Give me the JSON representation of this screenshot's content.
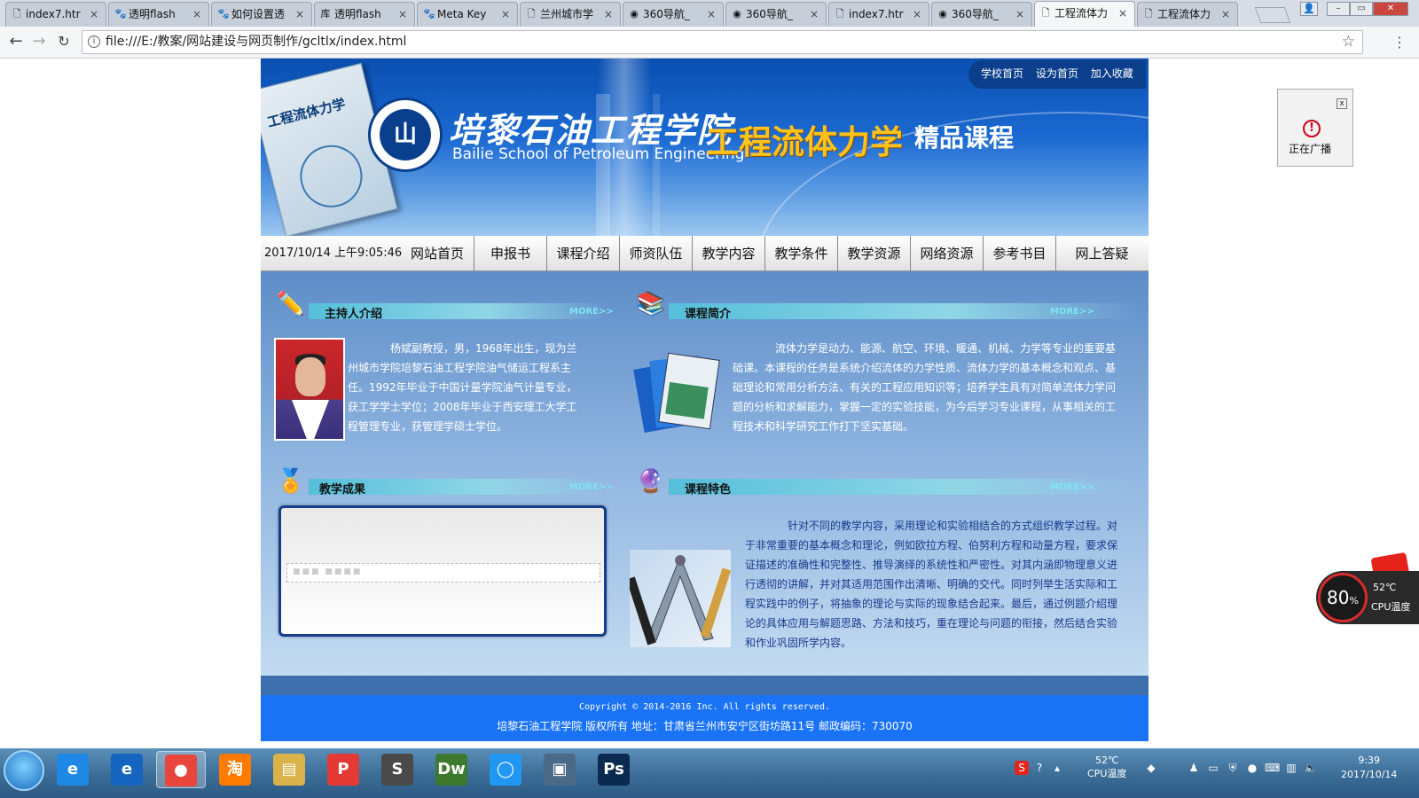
{
  "browser": {
    "tabs": [
      {
        "title": "index7.htr",
        "icon": "doc"
      },
      {
        "title": "透明flash",
        "icon": "baidu-paw"
      },
      {
        "title": "如何设置透",
        "icon": "baidu-paw"
      },
      {
        "title": "透明flash",
        "icon": "wenku"
      },
      {
        "title": "Meta Key",
        "icon": "baidu-paw"
      },
      {
        "title": "兰州城市学",
        "icon": "doc"
      },
      {
        "title": "360导航_",
        "icon": "360"
      },
      {
        "title": "360导航_",
        "icon": "360"
      },
      {
        "title": "index7.htr",
        "icon": "doc"
      },
      {
        "title": "360导航_",
        "icon": "360"
      },
      {
        "title": "工程流体力",
        "icon": "doc"
      },
      {
        "title": "工程流体力",
        "icon": "doc"
      }
    ],
    "active_tab": 10,
    "url": "file:///E:/教案/网站建设与网页制作/gcltlx/index.html"
  },
  "site": {
    "top_links": [
      "学校首页",
      "设为首页",
      "加入收藏"
    ],
    "book_title": "工程流体力学",
    "school_cn": "培黎石油工程学院",
    "school_en": "Bailie School of Petroleum Engineering",
    "seal_text": "山",
    "course_name": "工程流体力学",
    "course_tag": "精品课程",
    "clock": "2017/10/14  上午9:05:46",
    "nav": [
      "网站首页",
      "申报书",
      "课程介绍",
      "师资队伍",
      "教学内容",
      "教学条件",
      "教学资源",
      "网络资源",
      "参考书目",
      "网上答疑"
    ],
    "sections": {
      "host": {
        "title": "主持人介绍",
        "more": "MORE>>",
        "text": "杨斌副教授，男，1968年出生，现为兰州城市学院培黎石油工程学院油气储运工程系主任。1992年毕业于中国计量学院油气计量专业，获工学学士学位；2008年毕业于西安理工大学工程管理专业，获管理学硕士学位。"
      },
      "intro": {
        "title": "课程简介",
        "more": "MORE>>",
        "text": "流体力学是动力、能源、航空、环境、暖通、机械、力学等专业的重要基础课。本课程的任务是系统介绍流体的力学性质、流体力学的基本概念和观点、基础理论和常用分析方法、有关的工程应用知识等；培养学生具有对简单流体力学问题的分析和求解能力，掌握一定的实验技能，为今后学习专业课程，从事相关的工程技术和科学研究工作打下坚实基础。"
      },
      "results": {
        "title": "教学成果",
        "more": "MORE>>",
        "loading": "■■■ ■■■■"
      },
      "features": {
        "title": "课程特色",
        "more": "MORE>>",
        "text": "针对不同的教学内容，采用理论和实验相结合的方式组织教学过程。对于非常重要的基本概念和理论，例如欧拉方程、伯努利方程和动量方程，要求保证描述的准确性和完整性、推导演绎的系统性和严密性。对其内涵即物理意义进行透彻的讲解，并对其适用范围作出清晰、明确的交代。同时列举生活实际和工程实践中的例子，将抽象的理论与实际的现象结合起来。最后，通过例题介绍理论的具体应用与解题思路、方法和技巧，重在理论与问题的衔接，然后结合实验和作业巩固所学内容。"
      }
    },
    "footer": {
      "copyright": "Copyright © 2014-2016 Inc. All rights reserved.",
      "address": "培黎石油工程学院 版权所有 地址：甘肃省兰州市安宁区街坊路11号 邮政编码：730070"
    }
  },
  "widgets": {
    "radio_label": "正在广播",
    "cpu_usage": "80",
    "cpu_unit": "%",
    "cpu_temp": "52℃",
    "cpu_label": "CPU温度"
  },
  "taskbar": {
    "apps": [
      {
        "name": "ie-blue",
        "label": "e"
      },
      {
        "name": "ie-edge",
        "label": "e"
      },
      {
        "name": "chrome",
        "label": "●"
      },
      {
        "name": "taobao",
        "label": "淘"
      },
      {
        "name": "explorer",
        "label": "▤"
      },
      {
        "name": "wps-pdf",
        "label": "P"
      },
      {
        "name": "sublime",
        "label": "S"
      },
      {
        "name": "dreamweaver",
        "label": "Dw"
      },
      {
        "name": "qq-browser",
        "label": "◯"
      },
      {
        "name": "media",
        "label": "▣"
      },
      {
        "name": "photoshop",
        "label": "Ps"
      }
    ],
    "tray_temp": "52℃",
    "tray_temp_label": "CPU温度",
    "time": "9:39",
    "date": "2017/10/14"
  }
}
